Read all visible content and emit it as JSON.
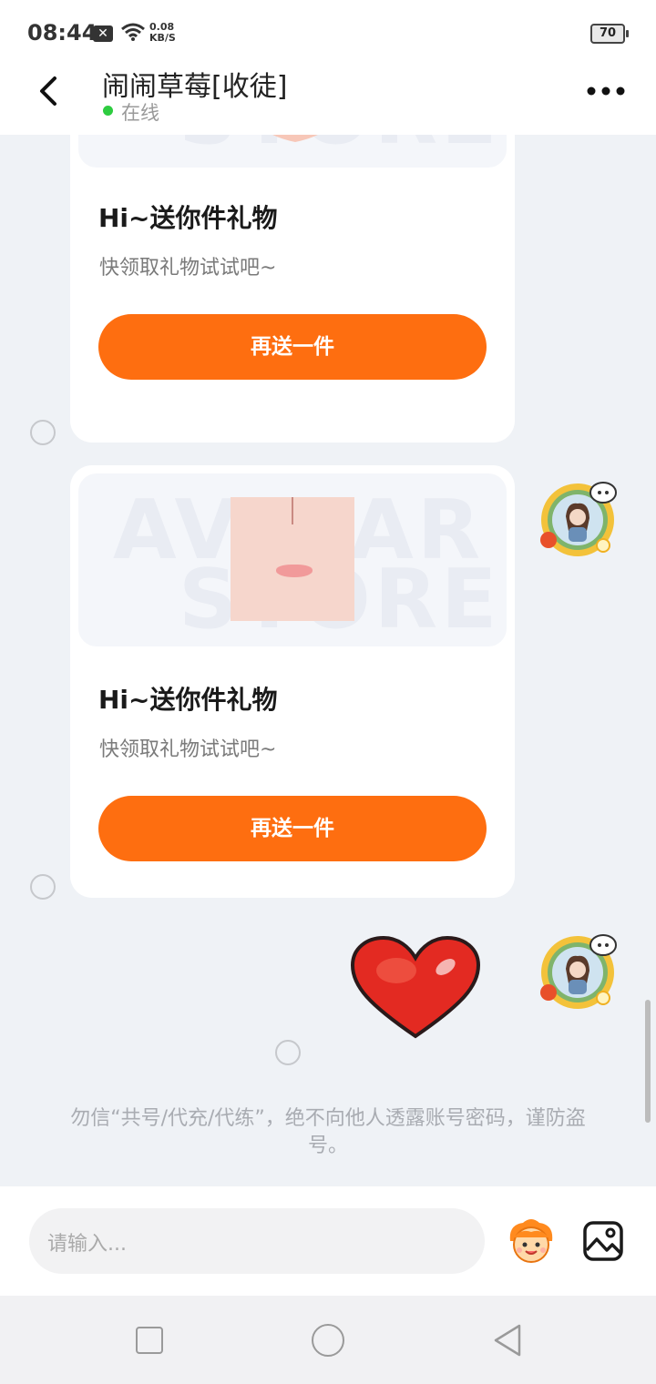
{
  "status_bar": {
    "time": "08:44",
    "net_speed_value": "0.08",
    "net_speed_unit": "KB/S",
    "battery": "70"
  },
  "header": {
    "title": "闹闹草莓[收徒]",
    "status": "在线"
  },
  "messages": [
    {
      "type": "gift_card",
      "title": "Hi~送你件礼物",
      "subtitle": "快领取礼物试试吧~",
      "button": "再送一件"
    },
    {
      "type": "gift_card",
      "title": "Hi~送你件礼物",
      "subtitle": "快领取礼物试试吧~",
      "button": "再送一件"
    },
    {
      "type": "sticker",
      "sticker": "heart-sticker"
    }
  ],
  "watermark": {
    "line1": "AVATAR",
    "line2": "STORE"
  },
  "notice": "勿信“共号/代充/代练”，绝不向他人透露账号密码，谨防盗号。",
  "input": {
    "placeholder": "请输入..."
  },
  "colors": {
    "accent": "#fe6e10",
    "online": "#2ecc40",
    "background": "#eff2f6"
  },
  "icons": [
    "back-arrow-icon",
    "more-icon",
    "emoji-icon",
    "image-icon",
    "wifi-icon"
  ]
}
